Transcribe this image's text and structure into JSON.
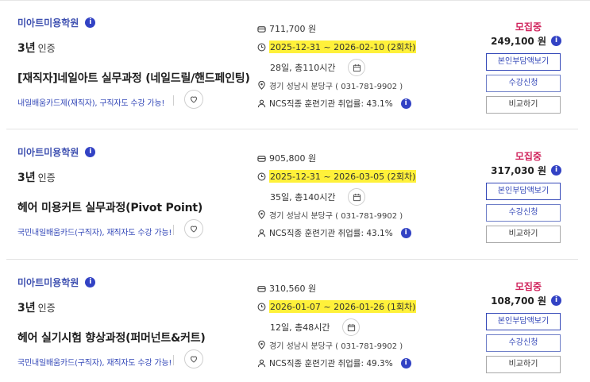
{
  "cards": [
    {
      "institution": "미아트미용학원",
      "cert_years": "3년",
      "cert_label": "인증",
      "title": "[재직자]네일아트 실무과정 (네일드릴/핸드페인팅)",
      "card_type": "내일배움카드제(재직자), 구직자도 수강 가능!",
      "price": "711,700 원",
      "date_range": "2025-12-31 ~ 2026-02-10 (2회차)",
      "duration": "28일, 총110시간",
      "address": "경기 성남시 분당구 ( 031-781-9902 )",
      "ncs": "NCS직종 훈련기관 취업률: 43.1%",
      "status": "모집중",
      "self_pay": "249,100 원",
      "btn_self_pay": "본인부담액보기",
      "btn_apply": "수강신청",
      "btn_compare": "비교하기"
    },
    {
      "institution": "미아트미용학원",
      "cert_years": "3년",
      "cert_label": "인증",
      "title": "헤어 미용커트 실무과정(Pivot Point)",
      "card_type": "국민내일배움카드(구직자), 재직자도 수강 가능!",
      "price": "905,800 원",
      "date_range": "2025-12-31 ~ 2026-03-05 (2회차)",
      "duration": "35일, 총140시간",
      "address": "경기 성남시 분당구 ( 031-781-9902 )",
      "ncs": "NCS직종 훈련기관 취업률: 43.1%",
      "status": "모집중",
      "self_pay": "317,030 원",
      "btn_self_pay": "본인부담액보기",
      "btn_apply": "수강신청",
      "btn_compare": "비교하기"
    },
    {
      "institution": "미아트미용학원",
      "cert_years": "3년",
      "cert_label": "인증",
      "title": "헤어 실기시험 향상과정(퍼머넌트&커트)",
      "card_type": "국민내일배움카드(구직자), 재직자도 수강 가능!",
      "price": "310,560 원",
      "date_range": "2026-01-07 ~ 2026-01-26 (1회차)",
      "duration": "12일, 총48시간",
      "address": "경기 성남시 분당구 ( 031-781-9902 )",
      "ncs": "NCS직종 훈련기관 취업률: 49.3%",
      "status": "모집중",
      "self_pay": "108,700 원",
      "btn_self_pay": "본인부담액보기",
      "btn_apply": "수강신청",
      "btn_compare": "비교하기"
    }
  ],
  "icons": {
    "info": "info-icon",
    "wallet": "wallet-icon",
    "clock": "clock-icon",
    "calendar": "calendar-icon",
    "location": "location-pin-icon",
    "person": "person-icon",
    "heart": "heart-icon"
  },
  "colors": {
    "institution": "#3d4fb0",
    "status": "#d0245c",
    "highlight": "#fff13a",
    "primary": "#3448b8"
  },
  "info_mark": "i"
}
